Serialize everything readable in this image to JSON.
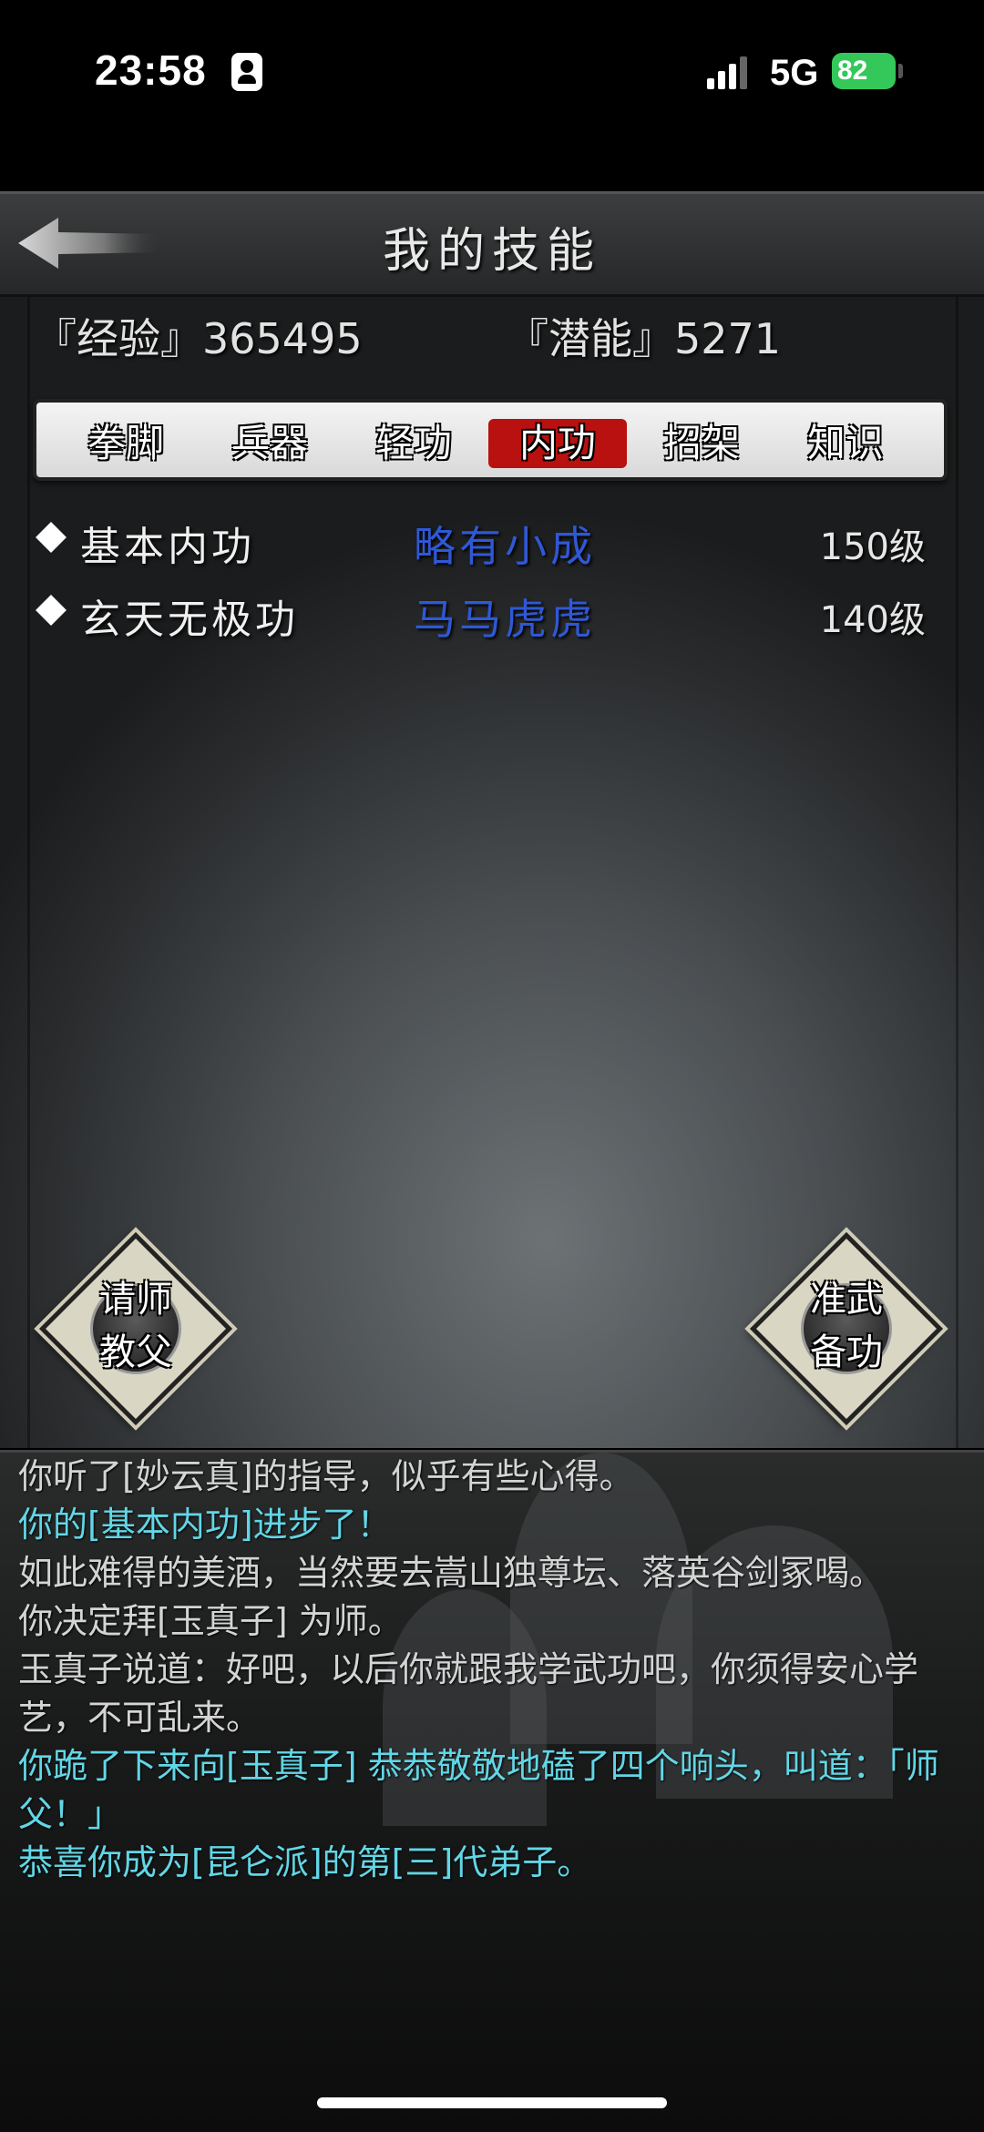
{
  "status_bar": {
    "time": "23:58",
    "network": "5G",
    "battery": "82"
  },
  "header": {
    "title": "我的技能",
    "back_icon": "left-arrow-icon"
  },
  "stats": {
    "experience": "『经验』365495",
    "potential": "『潜能』5271"
  },
  "tabs": [
    {
      "label": "拳脚",
      "active": false
    },
    {
      "label": "兵器",
      "active": false
    },
    {
      "label": "轻功",
      "active": false
    },
    {
      "label": "内功",
      "active": true
    },
    {
      "label": "招架",
      "active": false
    },
    {
      "label": "知识",
      "active": false
    }
  ],
  "skills": [
    {
      "name": "基本内功",
      "rank": "略有小成",
      "level": "150级"
    },
    {
      "name": "玄天无极功",
      "rank": "马马虎虎",
      "level": "140级"
    }
  ],
  "buttons": {
    "teacher_line1": "请师",
    "teacher_line2": "教父",
    "prepare_line1": "准武",
    "prepare_line2": "备功"
  },
  "log": [
    {
      "text": "你听了[妙云真]的指导，似乎有些心得。",
      "highlight": false
    },
    {
      "text": "你的[基本内功]进步了！",
      "highlight": true
    },
    {
      "text": "如此难得的美酒，当然要去嵩山独尊坛、落英谷剑冢喝。",
      "highlight": false
    },
    {
      "text": "你决定拜[玉真子] 为师。",
      "highlight": false
    },
    {
      "text": "玉真子说道：好吧，以后你就跟我学武功吧，你须得安心学艺，不可乱来。",
      "highlight": false
    },
    {
      "text": "你跪了下来向[玉真子] 恭恭敬敬地磕了四个响头，叫道：「师父！」",
      "highlight": true
    },
    {
      "text": "恭喜你成为[昆仑派]的第[三]代弟子。",
      "highlight": true
    }
  ],
  "colors": {
    "active_tab": "#b8110f",
    "skill_rank": "#2f58d6",
    "log_highlight": "#62d6e6",
    "battery": "#34c759"
  }
}
